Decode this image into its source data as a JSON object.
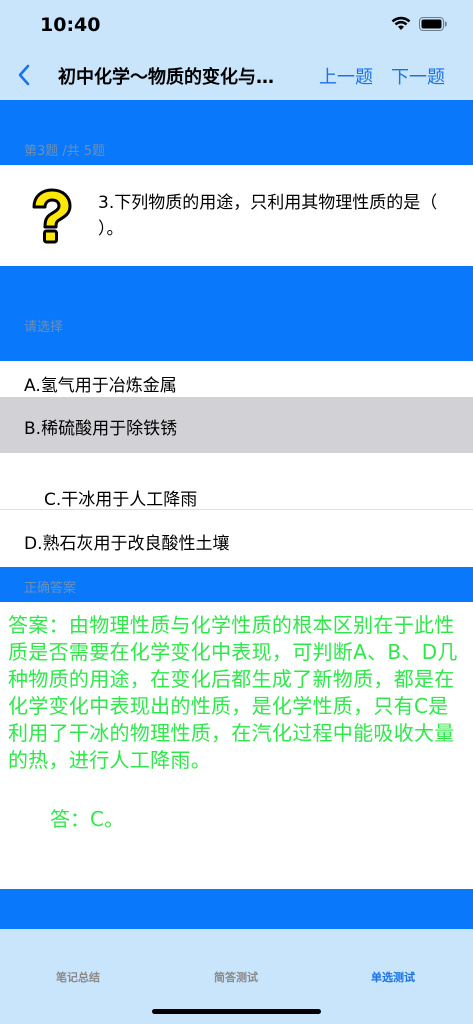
{
  "status": {
    "time": "10:40",
    "icons": [
      "signal-icon",
      "wifi-icon",
      "battery-icon"
    ]
  },
  "nav": {
    "title": "初中化学～物质的变化与…",
    "prev_label": "上一题",
    "next_label": "下一题",
    "accent_color": "#1a73e8"
  },
  "progress": {
    "label": "第3题 /共 5题"
  },
  "question": {
    "icon": "question-mark-icon",
    "text": "3.下列物质的用途，只利用其物理性质的是（   ）。"
  },
  "options_section": {
    "label": "请选择"
  },
  "options": [
    {
      "label": "A.氢气用于冶炼金属"
    },
    {
      "label": "B.稀硫酸用于除铁锈"
    },
    {
      "label": "C.干冰用于人工降雨"
    },
    {
      "label": "D.熟石灰用于改良酸性土壤"
    }
  ],
  "answer_section": {
    "label": "正确答案",
    "text": "答案：由物理性质与化学性质的根本区别在于此性质是否需要在化学变化中表现，可判断A、B、D几种物质的用途，在变化后都生成了新物质，都是在化学变化中表现出的性质，是化学性质，只有C是利用了干冰的物理性质，在汽化过程中能吸收大量的热，进行人工降雨。",
    "final": "答：C。",
    "color": "#2ee84a"
  },
  "tabs": [
    {
      "label": "笔记总结"
    },
    {
      "label": "简答测试"
    },
    {
      "label": "单选测试"
    }
  ]
}
